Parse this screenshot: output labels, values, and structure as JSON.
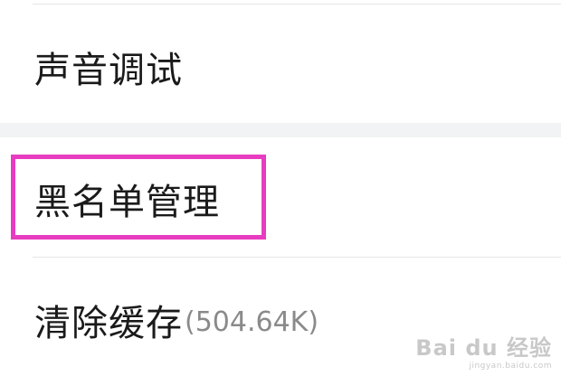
{
  "settings": {
    "items": [
      {
        "label": "声音调试"
      },
      {
        "label": "黑名单管理"
      },
      {
        "label": "清除缓存",
        "suffix": "(504.64K)"
      }
    ]
  },
  "annotation": {
    "highlight_color": "#e83cc0"
  },
  "watermark": {
    "brand": "Bai du 经验",
    "url": "jingyan.baidu.com"
  }
}
